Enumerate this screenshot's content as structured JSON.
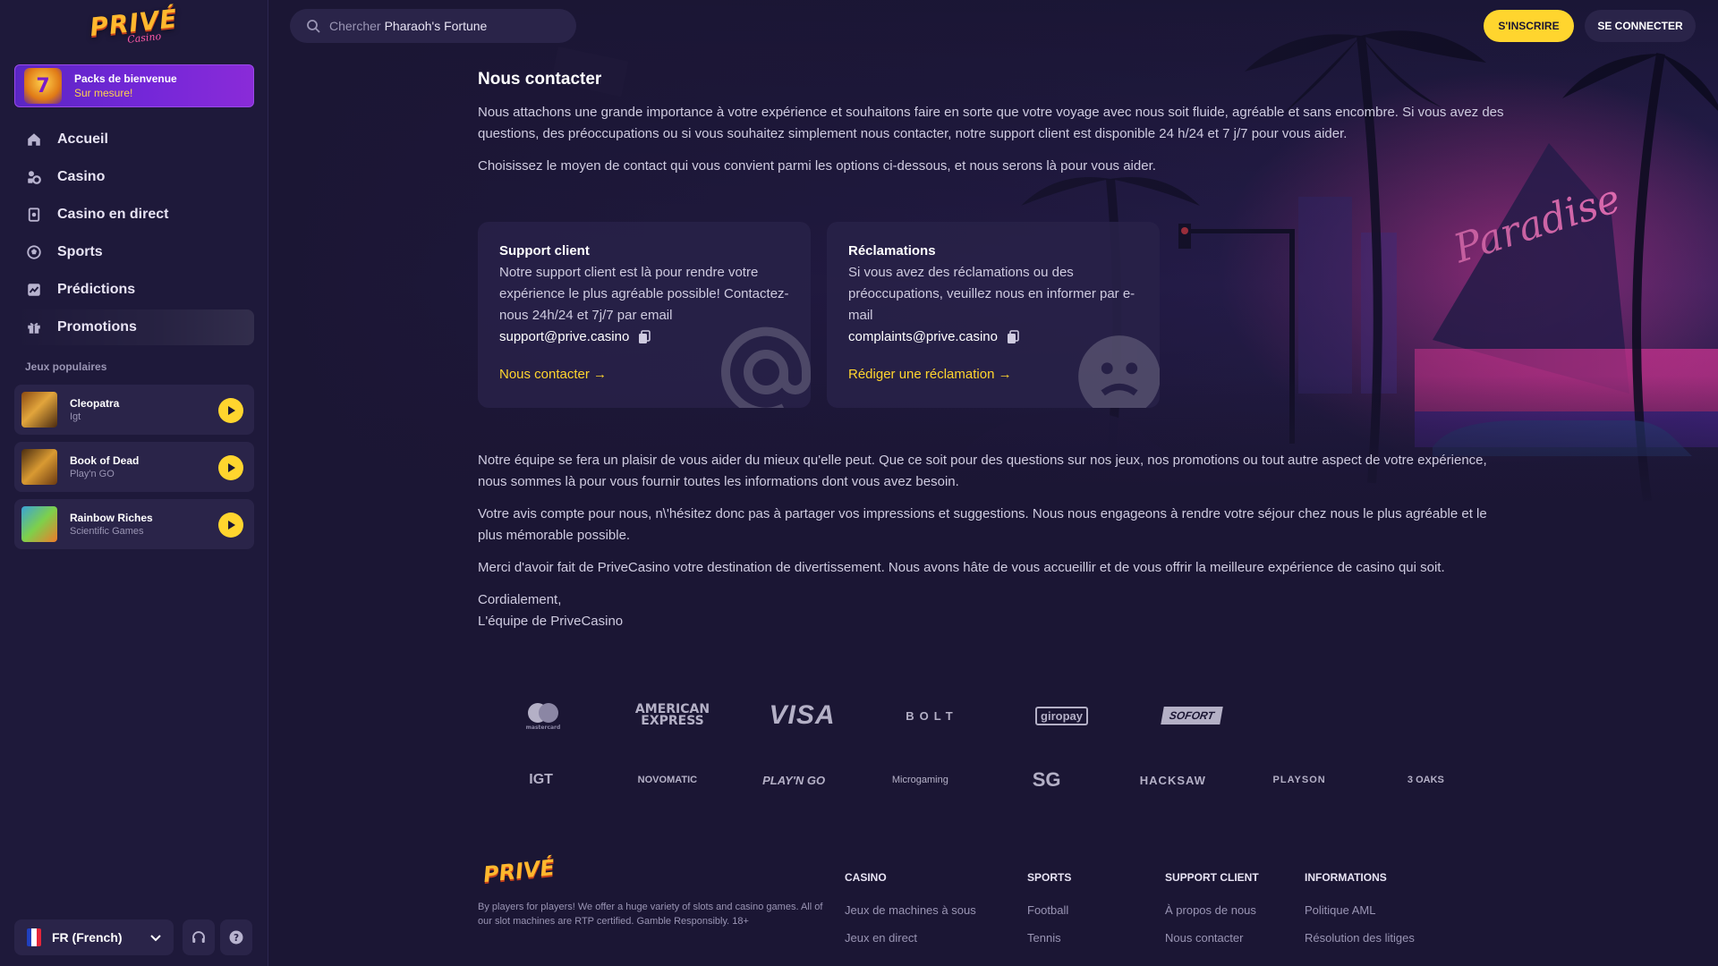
{
  "brand": {
    "logo_text": "PRIVÉ",
    "logo_sub": "Casino",
    "accent": "#ffd52e",
    "purple": "#7427d8"
  },
  "header": {
    "search_prefix": "Chercher",
    "search_query": "Pharaoh's Fortune",
    "signup_label": "S'INSCRIRE",
    "login_label": "SE CONNECTER"
  },
  "sidebar": {
    "welcome_title": "Packs de bienvenue",
    "welcome_sub": "Sur mesure!",
    "nav": [
      {
        "label": "Accueil",
        "icon": "home-icon"
      },
      {
        "label": "Casino",
        "icon": "casino-icon"
      },
      {
        "label": "Casino en direct",
        "icon": "live-casino-icon"
      },
      {
        "label": "Sports",
        "icon": "sports-icon"
      },
      {
        "label": "Prédictions",
        "icon": "predictions-icon"
      },
      {
        "label": "Promotions",
        "icon": "gift-icon"
      }
    ],
    "popular_title": "Jeux populaires",
    "games": [
      {
        "name": "Cleopatra",
        "provider": "Igt"
      },
      {
        "name": "Book of Dead",
        "provider": "Play'n GO"
      },
      {
        "name": "Rainbow Riches",
        "provider": "Scientific Games"
      }
    ],
    "language": "FR (French)"
  },
  "main": {
    "title": "Nous contacter",
    "intro1": "Nous attachons une grande importance à votre expérience et souhaitons faire en sorte que votre voyage avec nous soit fluide, agréable et sans encombre. Si vous avez des questions, des préoccupations ou si vous souhaitez simplement nous contacter, notre support client est disponible 24 h/24 et 7 j/7 pour vous aider.",
    "intro2": "Choisissez le moyen de contact qui vous convient parmi les options ci-dessous, et nous serons là pour vous aider.",
    "cards": [
      {
        "title": "Support client",
        "desc": "Notre support client est là pour rendre votre expérience le plus agréable possible! Contactez-nous 24h/24 et 7j/7 par email",
        "email": "support@prive.casino",
        "link": "Nous contacter →"
      },
      {
        "title": "Réclamations",
        "desc": "Si vous avez des réclamations ou des préoccupations, veuillez nous en informer par e-mail",
        "email": "complaints@prive.casino",
        "link": "Rédiger une réclamation →"
      }
    ],
    "body1": "Notre équipe se fera un plaisir de vous aider du mieux qu'elle peut. Que ce soit pour des questions sur nos jeux, nos promotions ou tout autre aspect de votre expérience, nous sommes là pour vous fournir toutes les informations dont vous avez besoin.",
    "body2": "Votre avis compte pour nous, n\\'hésitez donc pas à partager vos impressions et suggestions. Nous nous engageons à rendre votre séjour chez nous le plus agréable et le plus mémorable possible.",
    "body3": "Merci d'avoir fait de PriveCasino votre destination de divertissement. Nous avons hâte de vous accueillir et de vous offrir la meilleure expérience de casino qui soit.",
    "signoff1": "Cordialement,",
    "signoff2": "L'équipe de PriveCasino"
  },
  "payments": [
    "mastercard",
    "AMERICAN EXPRESS",
    "VISA",
    "BOLT",
    "giropay",
    "SOFORT"
  ],
  "providers": [
    "IGT",
    "NOVOMATIC",
    "PLAY'N GO",
    "Microgaming",
    "SG",
    "HACKSAW",
    "PLAYSON",
    "3 OAKS"
  ],
  "footer": {
    "desc": "By players for players! We offer a huge variety of slots and casino games. All of our slot machines are RTP certified. Gamble Responsibly. 18+",
    "columns": [
      {
        "title": "CASINO",
        "links": [
          "Jeux de machines à sous",
          "Jeux en direct"
        ]
      },
      {
        "title": "SPORTS",
        "links": [
          "Football",
          "Tennis"
        ]
      },
      {
        "title": "SUPPORT CLIENT",
        "links": [
          "À propos de nous",
          "Nous contacter"
        ]
      },
      {
        "title": "INFORMATIONS",
        "links": [
          "Politique AML",
          "Résolution des litiges"
        ]
      }
    ]
  }
}
